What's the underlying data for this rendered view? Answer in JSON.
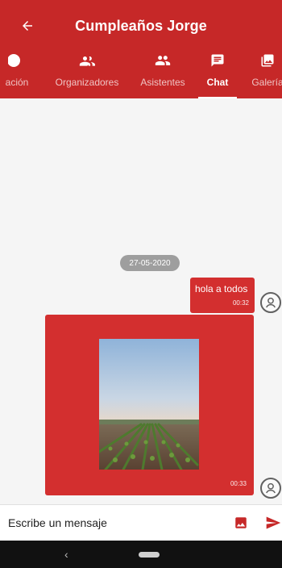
{
  "header": {
    "title": "Cumpleaños Jorge",
    "back_icon": "arrow-back-icon"
  },
  "tabs": [
    {
      "label": "ación",
      "icon": "info-icon",
      "active": false
    },
    {
      "label": "Organizadores",
      "icon": "people-icon",
      "active": false
    },
    {
      "label": "Asistentes",
      "icon": "group-icon",
      "active": false
    },
    {
      "label": "Chat",
      "icon": "chat-icon",
      "active": true
    },
    {
      "label": "Galería",
      "icon": "photo-library-icon",
      "active": false
    }
  ],
  "chat": {
    "date_separator": "27-05-2020",
    "messages": [
      {
        "type": "text",
        "text": "hola a todos",
        "time": "00:32"
      },
      {
        "type": "image",
        "time": "00:33"
      }
    ]
  },
  "composer": {
    "placeholder": "Escribe un mensaje",
    "gallery_icon": "image-icon",
    "send_icon": "send-icon"
  },
  "colors": {
    "primary": "#c62828",
    "bubble": "#d32f2f",
    "date_chip": "#9e9e9e",
    "background": "#f5f5f5"
  }
}
